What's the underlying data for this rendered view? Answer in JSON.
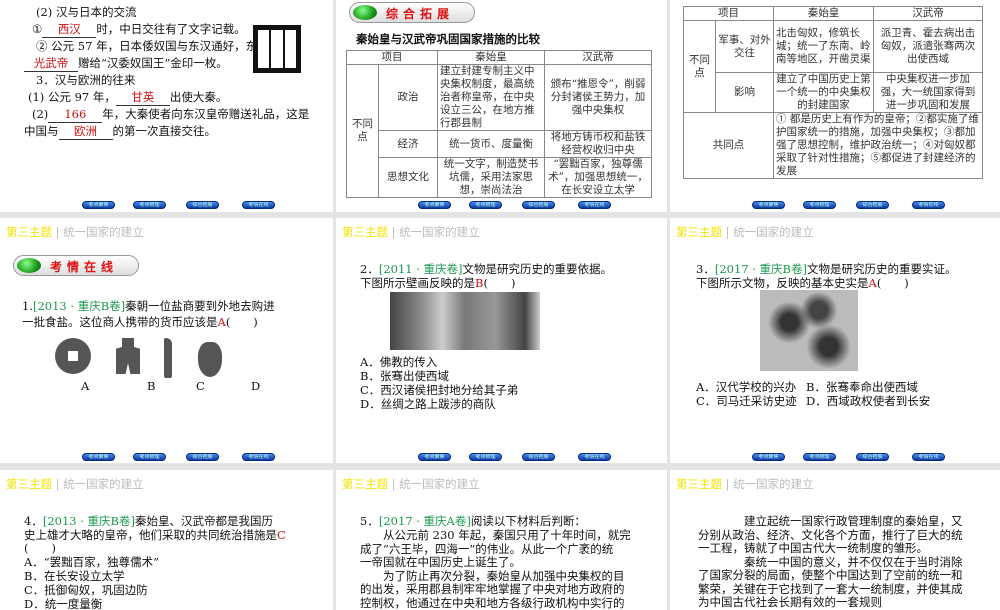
{
  "header": {
    "theme": "第三主题",
    "sep": "|",
    "title": "统一国家的建立"
  },
  "nav": [
    "考点聚焦",
    "考点梳理",
    "综合拓展",
    "考情在线"
  ],
  "slide1": {
    "lines": [
      {
        "pre": "(2) 汉与日本的交流"
      },
      {
        "pre": "①",
        "ans": "西汉",
        "post": "时，中日交往有了文字记载。"
      },
      {
        "pre": "② 公元 57 年，日本倭奴国与东汉通好，东汉"
      },
      {
        "ans": "光武帝",
        "post": "赠给“汉委奴国王”金印一枚。"
      },
      {
        "pre": "3．汉与欧洲的往来"
      },
      {
        "pre": "(1) 公元 97 年，",
        "ans": "甘英",
        "post": "出使大秦。"
      },
      {
        "pre": "(2)",
        "ans": "166",
        "post": "年，大秦使者向东汉皇帝赠送礼品，这是"
      },
      {
        "pre": "中国与",
        "ans": "欧洲",
        "post": "的第一次直接交往。"
      }
    ],
    "seal_text": "漢委奴國王"
  },
  "slide2": {
    "section": "综合拓展",
    "title": "秦始皇与汉武帝巩固国家措施的比较",
    "headers": [
      "项目",
      "秦始皇",
      "汉武帝"
    ],
    "group": "不同点",
    "rows": [
      [
        "政治",
        "建立封建专制主义中央集权制度，最高统治者称皇帝，在中央设立三公，在地方推行郡县制",
        "颁布“推恩令”，削弱分封诸侯王势力，加强中央集权"
      ],
      [
        "经济",
        "统一货币、度量衡",
        "将地方铸币权和盐铁经营权收归中央"
      ],
      [
        "思想文化",
        "统一文字，制造焚书坑儒，采用法家思想，崇尚法治",
        "“罢黜百家，独尊儒术”，加强思想统一，在长安设立太学"
      ]
    ]
  },
  "slide3": {
    "headers": [
      "项目",
      "秦始皇",
      "汉武帝"
    ],
    "group": "不同点",
    "rows": [
      [
        "军事、对外交往",
        "北击匈奴，修筑长城；统一了东南、岭南等地区，开凿灵渠",
        "派卫青、霍去病出击匈奴，派遣张骞两次出使西域"
      ],
      [
        "影响",
        "建立了中国历史上第一个统一的中央集权的封建国家",
        "中央集权进一步加强，大一统国家得到进一步巩固和发展"
      ]
    ],
    "common_label": "共同点",
    "common": "① 都是历史上有作为的皇帝；②都实施了维护国家统一的措施，加强中央集权；③都加强了思想控制，维护政治统一；④对匈奴都采取了针对性措施；⑤都促进了封建经济的发展"
  },
  "slide4": {
    "section": "考情在线",
    "num": "1.",
    "source": "[2013 · 重庆B卷]",
    "q1": "秦朝一位盐商要到外地去购进",
    "q2": "一批食盐。这位商人携带的货币应该是",
    "ans": "A",
    "paren": "(　　)",
    "labels": [
      "A",
      "B",
      "C",
      "D"
    ]
  },
  "slide5": {
    "num": "2．",
    "source": "[2011 · 重庆卷]",
    "q1": "文物是研究历史的重要依据。",
    "q2": "下图所示壁画反映的是",
    "ans": "B",
    "paren": "(　　)",
    "options": [
      "A．佛教的传入",
      "B．张骞出使西域",
      "C．西汉诸侯把封地分给其子弟",
      "D．丝绸之路上跋涉的商队"
    ]
  },
  "slide6": {
    "num": "3．",
    "source": "[2017 · 重庆B卷]",
    "q1": "文物是研究历史的重要实证。",
    "q2": "下图所示文物，反映的基本史实是",
    "ans": "A",
    "paren": "(　　)",
    "options": [
      "A．汉代学校的兴办",
      "B．张骞奉命出使西域",
      "C．司马迁采访史迹",
      "D．西域政权使者到长安"
    ]
  },
  "slide7": {
    "num": "4．",
    "source": "[2013 · 重庆B卷]",
    "q1": "秦始皇、汉武帝都是我国历",
    "q2": "史上雄才大略的皇帝，他们采取的共同统治措施是",
    "ans": "C",
    "paren": "(　　)",
    "options": [
      "A．“罢黜百家，独尊儒术”",
      "B．在长安设立太学",
      "C．抵御匈奴，巩固边防",
      "D．统一度量衡"
    ]
  },
  "slide8": {
    "num": "5．",
    "source": "[2017 · 重庆A卷]",
    "q1": "阅读以下材料后判断：",
    "lines": [
      "　　从公元前 230 年起，秦国只用了十年时间，就完",
      "成了“六王毕，四海一”的伟业。从此一个广袤的统",
      "一帝国就在中国历史上诞生了。",
      "　　为了防止再次分裂，秦始皇从加强中央集权的目",
      "的出发，采用郡县制牢牢地掌握了中央对地方政府的",
      "控制权，他通过在中央和地方各级行政机构中实行的"
    ]
  },
  "slide9": {
    "lines": [
      "　　　　建立起统一国家行政管理制度的秦始皇，又",
      "分别从政治、经济、文化各个方面，推行了巨大的统",
      "一工程，铸就了中国古代大一统制度的雏形。",
      "　　　　秦统一中国的意义，并不仅仅在于当时消除",
      "了国家分裂的局面，使整个中国达到了空前的统一和",
      "繁荣，关键在于它找到了一套大一统制度，并使其成",
      "为中国古代社会长期有效的一套规则"
    ]
  }
}
